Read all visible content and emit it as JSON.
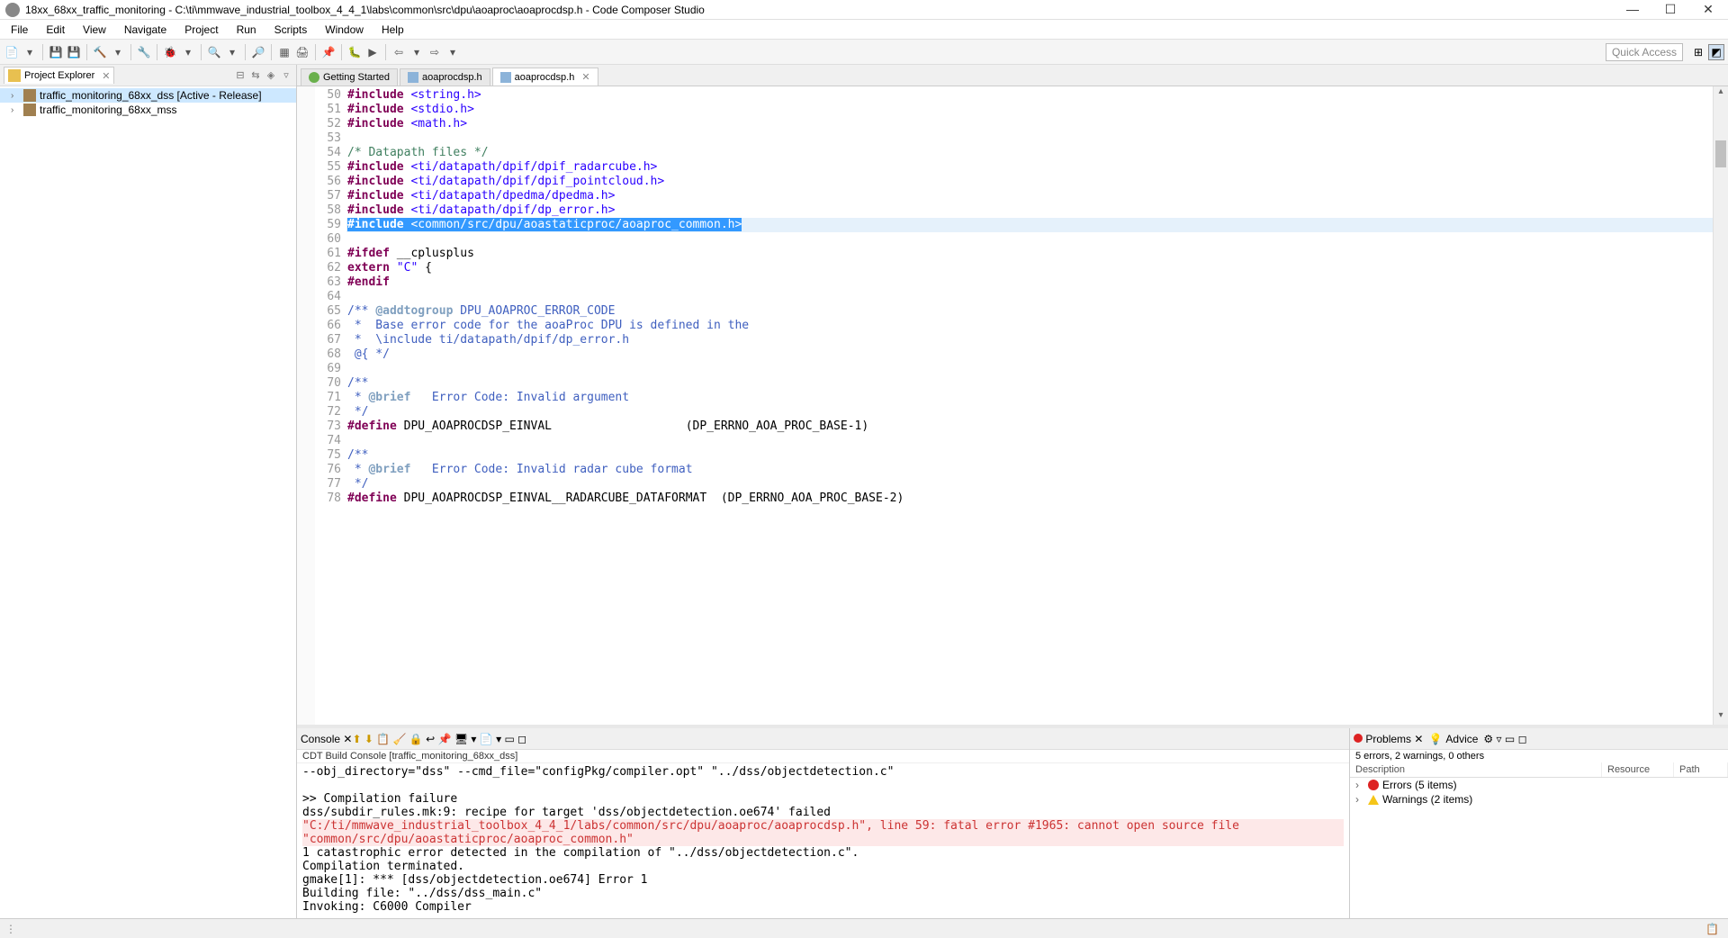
{
  "window": {
    "title": "18xx_68xx_traffic_monitoring - C:\\ti\\mmwave_industrial_toolbox_4_4_1\\labs\\common\\src\\dpu\\aoaproc\\aoaprocdsp.h - Code Composer Studio"
  },
  "menu": [
    "File",
    "Edit",
    "View",
    "Navigate",
    "Project",
    "Run",
    "Scripts",
    "Window",
    "Help"
  ],
  "quick_access_label": "Quick Access",
  "project_explorer": {
    "title": "Project Explorer",
    "items": [
      {
        "label": "traffic_monitoring_68xx_dss  [Active - Release]",
        "selected": true
      },
      {
        "label": "traffic_monitoring_68xx_mss",
        "selected": false
      }
    ]
  },
  "editor": {
    "tabs": [
      {
        "label": "Getting Started",
        "icon": "globe",
        "active": false,
        "closable": false
      },
      {
        "label": "aoaprocdsp.h",
        "icon": "h-file",
        "active": false,
        "closable": false
      },
      {
        "label": "aoaprocdsp.h",
        "icon": "h-file",
        "active": true,
        "closable": true
      }
    ],
    "lines": [
      {
        "n": 50,
        "tokens": [
          {
            "t": "#include ",
            "c": "kw"
          },
          {
            "t": "<string.h>",
            "c": "str"
          }
        ]
      },
      {
        "n": 51,
        "tokens": [
          {
            "t": "#include ",
            "c": "kw"
          },
          {
            "t": "<stdio.h>",
            "c": "str"
          }
        ]
      },
      {
        "n": 52,
        "tokens": [
          {
            "t": "#include ",
            "c": "kw"
          },
          {
            "t": "<math.h>",
            "c": "str"
          }
        ]
      },
      {
        "n": 53,
        "tokens": []
      },
      {
        "n": 54,
        "tokens": [
          {
            "t": "/* Datapath files */",
            "c": "cmt"
          }
        ]
      },
      {
        "n": 55,
        "tokens": [
          {
            "t": "#include ",
            "c": "kw"
          },
          {
            "t": "<ti/datapath/dpif/dpif_radarcube.h>",
            "c": "str"
          }
        ]
      },
      {
        "n": 56,
        "tokens": [
          {
            "t": "#include ",
            "c": "kw"
          },
          {
            "t": "<ti/datapath/dpif/dpif_pointcloud.h>",
            "c": "str"
          }
        ]
      },
      {
        "n": 57,
        "tokens": [
          {
            "t": "#include ",
            "c": "kw"
          },
          {
            "t": "<ti/datapath/dpedma/dpedma.h>",
            "c": "str"
          }
        ]
      },
      {
        "n": 58,
        "tokens": [
          {
            "t": "#include ",
            "c": "kw"
          },
          {
            "t": "<ti/datapath/dpif/dp_error.h>",
            "c": "str"
          }
        ]
      },
      {
        "n": 59,
        "highlighted": true,
        "tokens": [
          {
            "t": "#include ",
            "c": "kw sel"
          },
          {
            "t": "<common/src/dpu/aoastaticproc/aoaproc_common.h>",
            "c": "str sel"
          }
        ]
      },
      {
        "n": 60,
        "tokens": []
      },
      {
        "n": 61,
        "tokens": [
          {
            "t": "#ifdef ",
            "c": "kw"
          },
          {
            "t": "__cplusplus",
            "c": ""
          }
        ]
      },
      {
        "n": 62,
        "tokens": [
          {
            "t": "extern ",
            "c": "kw"
          },
          {
            "t": "\"C\"",
            "c": "str"
          },
          {
            "t": " {",
            "c": ""
          }
        ]
      },
      {
        "n": 63,
        "tokens": [
          {
            "t": "#endif",
            "c": "kw"
          }
        ]
      },
      {
        "n": 64,
        "tokens": []
      },
      {
        "n": 65,
        "tokens": [
          {
            "t": "/** ",
            "c": "doc"
          },
          {
            "t": "@addtogroup",
            "c": "doc-tag"
          },
          {
            "t": " DPU_AOAPROC_ERROR_CODE",
            "c": "doc"
          }
        ]
      },
      {
        "n": 66,
        "tokens": [
          {
            "t": " *  Base error code for the aoaProc DPU is defined in the",
            "c": "doc"
          }
        ]
      },
      {
        "n": 67,
        "tokens": [
          {
            "t": " *  \\include ti/datapath/dpif/dp_error.h",
            "c": "doc"
          }
        ]
      },
      {
        "n": 68,
        "tokens": [
          {
            "t": " @{ */",
            "c": "doc"
          }
        ]
      },
      {
        "n": 69,
        "tokens": []
      },
      {
        "n": 70,
        "tokens": [
          {
            "t": "/**",
            "c": "doc"
          }
        ]
      },
      {
        "n": 71,
        "tokens": [
          {
            "t": " * ",
            "c": "doc"
          },
          {
            "t": "@brief",
            "c": "doc-tag"
          },
          {
            "t": "   Error Code: Invalid argument",
            "c": "doc"
          }
        ]
      },
      {
        "n": 72,
        "tokens": [
          {
            "t": " */",
            "c": "doc"
          }
        ]
      },
      {
        "n": 73,
        "tokens": [
          {
            "t": "#define ",
            "c": "kw"
          },
          {
            "t": "DPU_AOAPROCDSP_EINVAL                   (DP_ERRNO_AOA_PROC_BASE-1)",
            "c": ""
          }
        ]
      },
      {
        "n": 74,
        "tokens": []
      },
      {
        "n": 75,
        "tokens": [
          {
            "t": "/**",
            "c": "doc"
          }
        ]
      },
      {
        "n": 76,
        "tokens": [
          {
            "t": " * ",
            "c": "doc"
          },
          {
            "t": "@brief",
            "c": "doc-tag"
          },
          {
            "t": "   Error Code: Invalid radar cube format",
            "c": "doc"
          }
        ]
      },
      {
        "n": 77,
        "tokens": [
          {
            "t": " */",
            "c": "doc"
          }
        ]
      },
      {
        "n": 78,
        "tokens": [
          {
            "t": "#define ",
            "c": "kw"
          },
          {
            "t": "DPU_AOAPROCDSP_EINVAL__RADARCUBE_DATAFORMAT  (DP_ERRNO_AOA_PROC_BASE-2)",
            "c": ""
          }
        ]
      }
    ]
  },
  "console": {
    "title": "Console",
    "subtitle": "CDT Build Console [traffic_monitoring_68xx_dss]",
    "lines": [
      {
        "text": "--obj_directory=\"dss\" --cmd_file=\"configPkg/compiler.opt\" \"../dss/objectdetection.c\"",
        "err": false
      },
      {
        "text": "",
        "err": false
      },
      {
        "text": ">> Compilation failure",
        "err": false
      },
      {
        "text": "dss/subdir_rules.mk:9: recipe for target 'dss/objectdetection.oe674' failed",
        "err": false
      },
      {
        "text": "\"C:/ti/mmwave_industrial_toolbox_4_4_1/labs/common/src/dpu/aoaproc/aoaprocdsp.h\", line 59: fatal error #1965: cannot open source file \"common/src/dpu/aoastaticproc/aoaproc_common.h\"",
        "err": true
      },
      {
        "text": "1 catastrophic error detected in the compilation of \"../dss/objectdetection.c\".",
        "err": false
      },
      {
        "text": "Compilation terminated.",
        "err": false
      },
      {
        "text": "gmake[1]: *** [dss/objectdetection.oe674] Error 1",
        "err": false
      },
      {
        "text": "Building file: \"../dss/dss_main.c\"",
        "err": false
      },
      {
        "text": "Invoking: C6000 Compiler",
        "err": false
      }
    ]
  },
  "problems": {
    "tab1": "Problems",
    "tab2": "Advice",
    "summary": "5 errors, 2 warnings, 0 others",
    "columns": {
      "desc": "Description",
      "res": "Resource",
      "path": "Path"
    },
    "rows": [
      {
        "icon": "err",
        "label": "Errors (5 items)"
      },
      {
        "icon": "warn",
        "label": "Warnings (2 items)"
      }
    ]
  }
}
